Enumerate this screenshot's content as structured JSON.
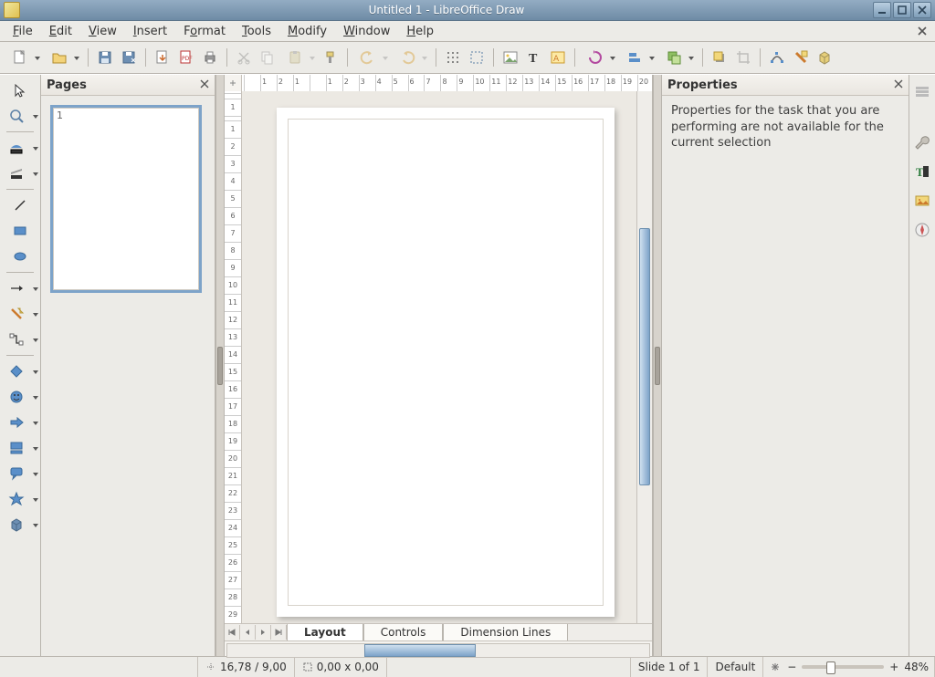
{
  "window": {
    "title": "Untitled 1 - LibreOffice Draw"
  },
  "menu": {
    "file": "File",
    "edit": "Edit",
    "view": "View",
    "insert": "Insert",
    "format": "Format",
    "tools": "Tools",
    "modify": "Modify",
    "window": "Window",
    "help": "Help"
  },
  "panels": {
    "pages_title": "Pages",
    "properties_title": "Properties",
    "properties_message": "Properties for the task that you are performing are not available for the current selection",
    "page_number": "1"
  },
  "tabs": {
    "layout": "Layout",
    "controls": "Controls",
    "dimension": "Dimension Lines"
  },
  "status": {
    "cursor_pos": "16,78 / 9,00",
    "object_size": "0,00 x 0,00",
    "slide_info": "Slide 1 of 1",
    "page_style": "Default",
    "zoom": "48%"
  },
  "rulers": {
    "horizontal": [
      "",
      "1",
      "2",
      "1",
      "",
      "1",
      "2",
      "3",
      "4",
      "5",
      "6",
      "7",
      "8",
      "9",
      "10",
      "11",
      "12",
      "13",
      "14",
      "15",
      "16",
      "17",
      "18",
      "19",
      "20"
    ],
    "vertical": [
      "",
      "1",
      "",
      "1",
      "2",
      "3",
      "4",
      "5",
      "6",
      "7",
      "8",
      "9",
      "10",
      "11",
      "12",
      "13",
      "14",
      "15",
      "16",
      "17",
      "18",
      "19",
      "20",
      "21",
      "22",
      "23",
      "24",
      "25",
      "26",
      "27",
      "28",
      "29"
    ]
  }
}
